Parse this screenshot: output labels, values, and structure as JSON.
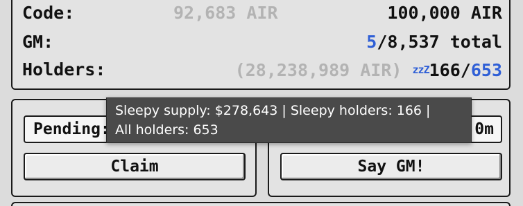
{
  "info": {
    "code": {
      "label": "Code:",
      "claimed": "92,683 AIR",
      "total": "100,000 AIR"
    },
    "gm": {
      "label": "GM:",
      "count": "5",
      "separator": "/",
      "total": "8,537 total"
    },
    "holders": {
      "label": "Holders:",
      "supply": "(28,238,989 AIR)",
      "sleepy_icon_text": "zzZ",
      "sleepy": "166",
      "separator": "/",
      "all": "653"
    }
  },
  "left_panel": {
    "pending_label": "Pending:",
    "claim_button": "Claim"
  },
  "right_panel": {
    "field_tail": "0m",
    "gm_button": "Say GM!"
  },
  "tooltip": {
    "line1": "Sleepy supply: $278,643 | Sleepy holders: 166 |",
    "line2": "All holders: 653"
  },
  "colors": {
    "accent_blue": "#2f5fd6",
    "muted_gray": "#b3b3b3",
    "tooltip_bg": "#4a4a4a",
    "panel_bg": "#e3e3e3"
  },
  "icons": {
    "sleepy": "sleep-zzz-icon"
  }
}
